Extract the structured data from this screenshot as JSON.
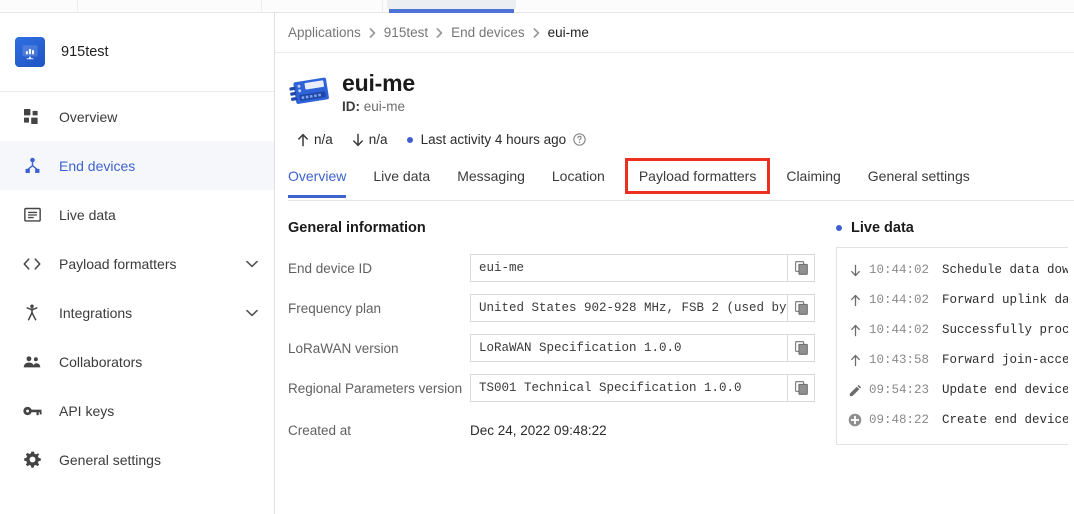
{
  "topbar": {
    "segments": [
      "",
      "",
      "",
      ""
    ],
    "accent_color": "#4f72d8"
  },
  "sidebar": {
    "brand": {
      "name": "915test",
      "logo_icon": "app-chart-monitor-icon"
    },
    "items": [
      {
        "label": "Overview",
        "icon": "grid-icon",
        "active": false,
        "chevron": false
      },
      {
        "label": "End devices",
        "icon": "device-node-icon",
        "active": true,
        "chevron": false
      },
      {
        "label": "Live data",
        "icon": "list-window-icon",
        "active": false,
        "chevron": false
      },
      {
        "label": "Payload formatters",
        "icon": "code-brackets-icon",
        "active": false,
        "chevron": true
      },
      {
        "label": "Integrations",
        "icon": "integration-icon",
        "active": false,
        "chevron": true
      },
      {
        "label": "Collaborators",
        "icon": "people-icon",
        "active": false,
        "chevron": false
      },
      {
        "label": "API keys",
        "icon": "key-icon",
        "active": false,
        "chevron": false
      },
      {
        "label": "General settings",
        "icon": "gear-icon",
        "active": false,
        "chevron": false
      }
    ]
  },
  "breadcrumb": [
    {
      "label": "Applications",
      "last": false
    },
    {
      "label": "915test",
      "last": false
    },
    {
      "label": "End devices",
      "last": false
    },
    {
      "label": "eui-me",
      "last": true
    }
  ],
  "page_header": {
    "device_icon": "lora-end-device-icon",
    "title": "eui-me",
    "id_prefix": "ID:",
    "id_value": "eui-me",
    "uplink_label": "n/a",
    "downlink_label": "n/a",
    "last_activity": "Last activity 4 hours ago",
    "help_icon": "question-circle-icon"
  },
  "tabs": [
    {
      "label": "Overview",
      "selected": true,
      "highlight": false
    },
    {
      "label": "Live data",
      "selected": false,
      "highlight": false
    },
    {
      "label": "Messaging",
      "selected": false,
      "highlight": false
    },
    {
      "label": "Location",
      "selected": false,
      "highlight": false
    },
    {
      "label": "Payload formatters",
      "selected": false,
      "highlight": true
    },
    {
      "label": "Claiming",
      "selected": false,
      "highlight": false
    },
    {
      "label": "General settings",
      "selected": false,
      "highlight": false
    }
  ],
  "highlight_color": "#ed2f21",
  "general_information": {
    "title": "General information",
    "fields": [
      {
        "label": "End device ID",
        "value": "eui-me",
        "copyable": true
      },
      {
        "label": "Frequency plan",
        "value": "United States 902-928 MHz, FSB 2 (used by…",
        "copyable": true
      },
      {
        "label": "LoRaWAN version",
        "value": "LoRaWAN Specification 1.0.0",
        "copyable": true
      },
      {
        "label": "Regional Parameters version",
        "value": "TS001 Technical Specification 1.0.0",
        "copyable": true
      },
      {
        "label": "Created at",
        "value": "Dec 24, 2022 09:48:22",
        "copyable": false
      }
    ],
    "copy_icon": "copy-icon"
  },
  "live_data": {
    "title": "Live data",
    "rows": [
      {
        "icon": "arrow-down-icon",
        "time": "10:44:02",
        "message": "Schedule data down"
      },
      {
        "icon": "arrow-up-icon",
        "time": "10:44:02",
        "message": "Forward uplink dat"
      },
      {
        "icon": "arrow-up-icon",
        "time": "10:44:02",
        "message": "Successfully proce"
      },
      {
        "icon": "arrow-up-icon",
        "time": "10:43:58",
        "message": "Forward join-accep"
      },
      {
        "icon": "pencil-icon",
        "time": "09:54:23",
        "message": "Update end device"
      },
      {
        "icon": "plus-circle-icon",
        "time": "09:48:22",
        "message": "Create end device"
      }
    ]
  }
}
